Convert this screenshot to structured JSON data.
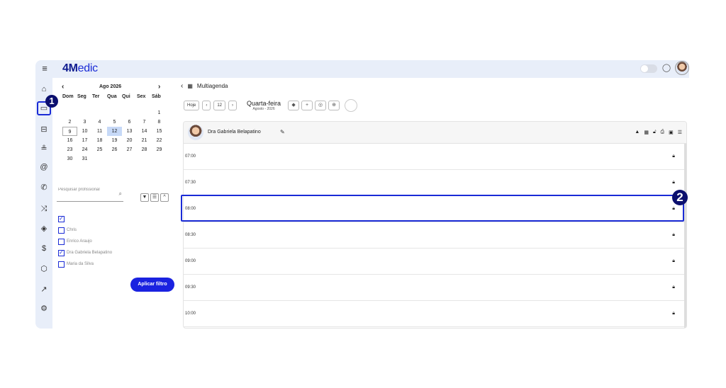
{
  "app": {
    "logo_prefix": "4M",
    "logo_suffix": "edic"
  },
  "topbar": {
    "menu_icon": "menu-icon",
    "chat_icon": "chat-icon"
  },
  "sidenav": {
    "items": [
      "home-icon",
      "calendar-icon",
      "sofa-icon",
      "user-icon",
      "at-icon",
      "phone-icon",
      "shuffle-icon",
      "tag-icon",
      "dollar-icon",
      "box-icon",
      "chart-icon",
      "settings-icon"
    ]
  },
  "calendar": {
    "month_label": "Ago 2026",
    "weekdays": [
      "Dom",
      "Seg",
      "Ter",
      "Qua",
      "Qui",
      "Sex",
      "Sáb"
    ],
    "weeks": [
      [
        "",
        "",
        "",
        "",
        "",
        "",
        "1"
      ],
      [
        "2",
        "3",
        "4",
        "5",
        "6",
        "7",
        "8"
      ],
      [
        "9",
        "10",
        "11",
        "12",
        "13",
        "14",
        "15"
      ],
      [
        "16",
        "17",
        "18",
        "19",
        "20",
        "21",
        "22"
      ],
      [
        "23",
        "24",
        "25",
        "26",
        "27",
        "28",
        "29"
      ],
      [
        "30",
        "31",
        "",
        "",
        "",
        "",
        ""
      ]
    ],
    "selected_day": "12",
    "today": "9"
  },
  "filter": {
    "search_placeholder": "Pesquisar profissional",
    "professionals": [
      {
        "name": "",
        "checked": true
      },
      {
        "name": "Chris",
        "checked": false
      },
      {
        "name": "Enrico Araujo",
        "checked": false
      },
      {
        "name": "Dra Gabriela Belapatino",
        "checked": true
      },
      {
        "name": "Maria da Silva",
        "checked": false
      }
    ],
    "apply_label": "Aplicar filtro"
  },
  "main": {
    "breadcrumb": "Multiagenda",
    "today_label": "Hoje",
    "day_number": "12",
    "weekday": "Quarta-feira",
    "month_year": "Agosto - 2026"
  },
  "agenda": {
    "professional": "Dra Gabriela Belapatino",
    "slots": [
      "07:00",
      "07:30",
      "08:00",
      "08:30",
      "09:00",
      "09:30",
      "10:00"
    ]
  },
  "annotations": {
    "badge_1": "1",
    "badge_2": "2"
  },
  "colors": {
    "accent": "#1a2bd6",
    "nav_bg": "#e8eef9",
    "badge": "#0b0f6e"
  }
}
